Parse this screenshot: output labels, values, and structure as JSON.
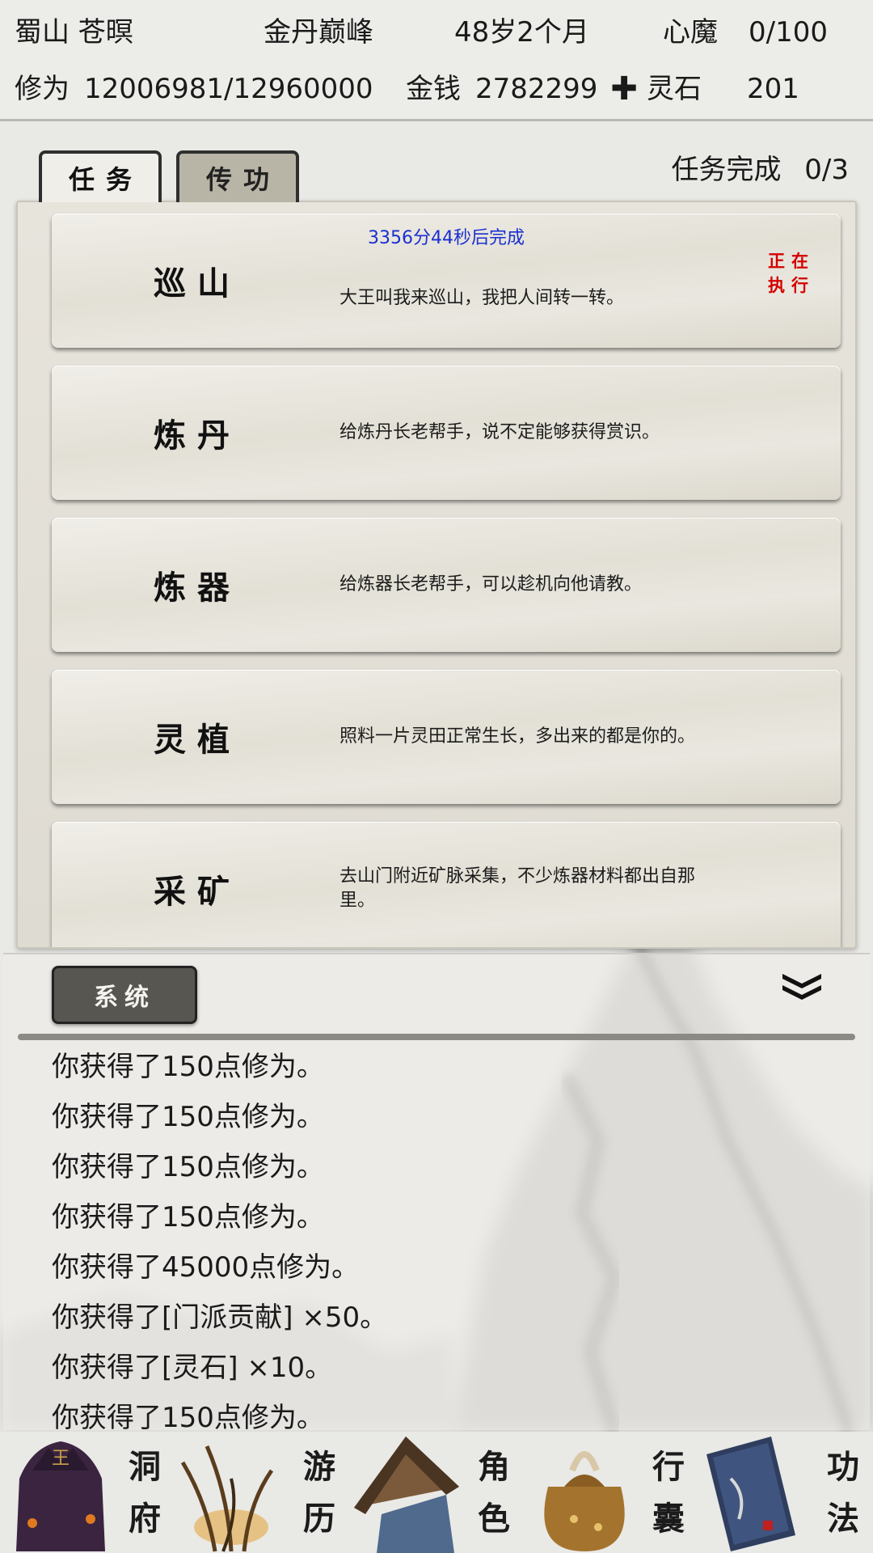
{
  "status": {
    "sect_name": "蜀山 苍暝",
    "realm": "金丹巅峰",
    "age": "48岁2个月",
    "demon_label": "心魔",
    "demon_value": "0/100",
    "cultivation_label": "修为",
    "cultivation_value": "12006981/12960000",
    "money_label": "金钱",
    "money_value": "2782299",
    "spirit_stone_icon": "✚",
    "spirit_stone_label": "灵石",
    "spirit_stone_value": "201"
  },
  "tabs": [
    {
      "label": "任务",
      "active": true
    },
    {
      "label": "传功",
      "active": false
    }
  ],
  "task_count_label": "任务完成",
  "task_count_value": "0/3",
  "tasks": [
    {
      "name": "巡山",
      "desc": "大王叫我来巡山，我把人间转一转。",
      "timer": "3356分44秒后完成",
      "status": "正在执行"
    },
    {
      "name": "炼丹",
      "desc": "给炼丹长老帮手，说不定能够获得赏识。"
    },
    {
      "name": "炼器",
      "desc": "给炼器长老帮手，可以趁机向他请教。"
    },
    {
      "name": "灵植",
      "desc": "照料一片灵田正常生长，多出来的都是你的。"
    },
    {
      "name": "采矿",
      "desc": "去山门附近矿脉采集，不少炼器材料都出自那里。"
    }
  ],
  "log": {
    "channel_label": "系统",
    "lines": [
      "你获得了150点修为。",
      "你获得了150点修为。",
      "你获得了150点修为。",
      "你获得了150点修为。",
      "你获得了45000点修为。",
      "你获得了[门派贡献] ×50。",
      "你获得了[灵石] ×10。",
      "你获得了150点修为。"
    ]
  },
  "nav": [
    {
      "label": "洞府",
      "icon": "cave-dwelling-icon"
    },
    {
      "label": "游历",
      "icon": "travel-grass-icon"
    },
    {
      "label": "角色",
      "icon": "straw-hat-character-icon"
    },
    {
      "label": "行囊",
      "icon": "bag-icon"
    },
    {
      "label": "功法",
      "icon": "scroll-book-icon"
    }
  ],
  "colors": {
    "timer": "#1a2fd0",
    "running": "#d40000",
    "accent_dark": "#585651"
  }
}
